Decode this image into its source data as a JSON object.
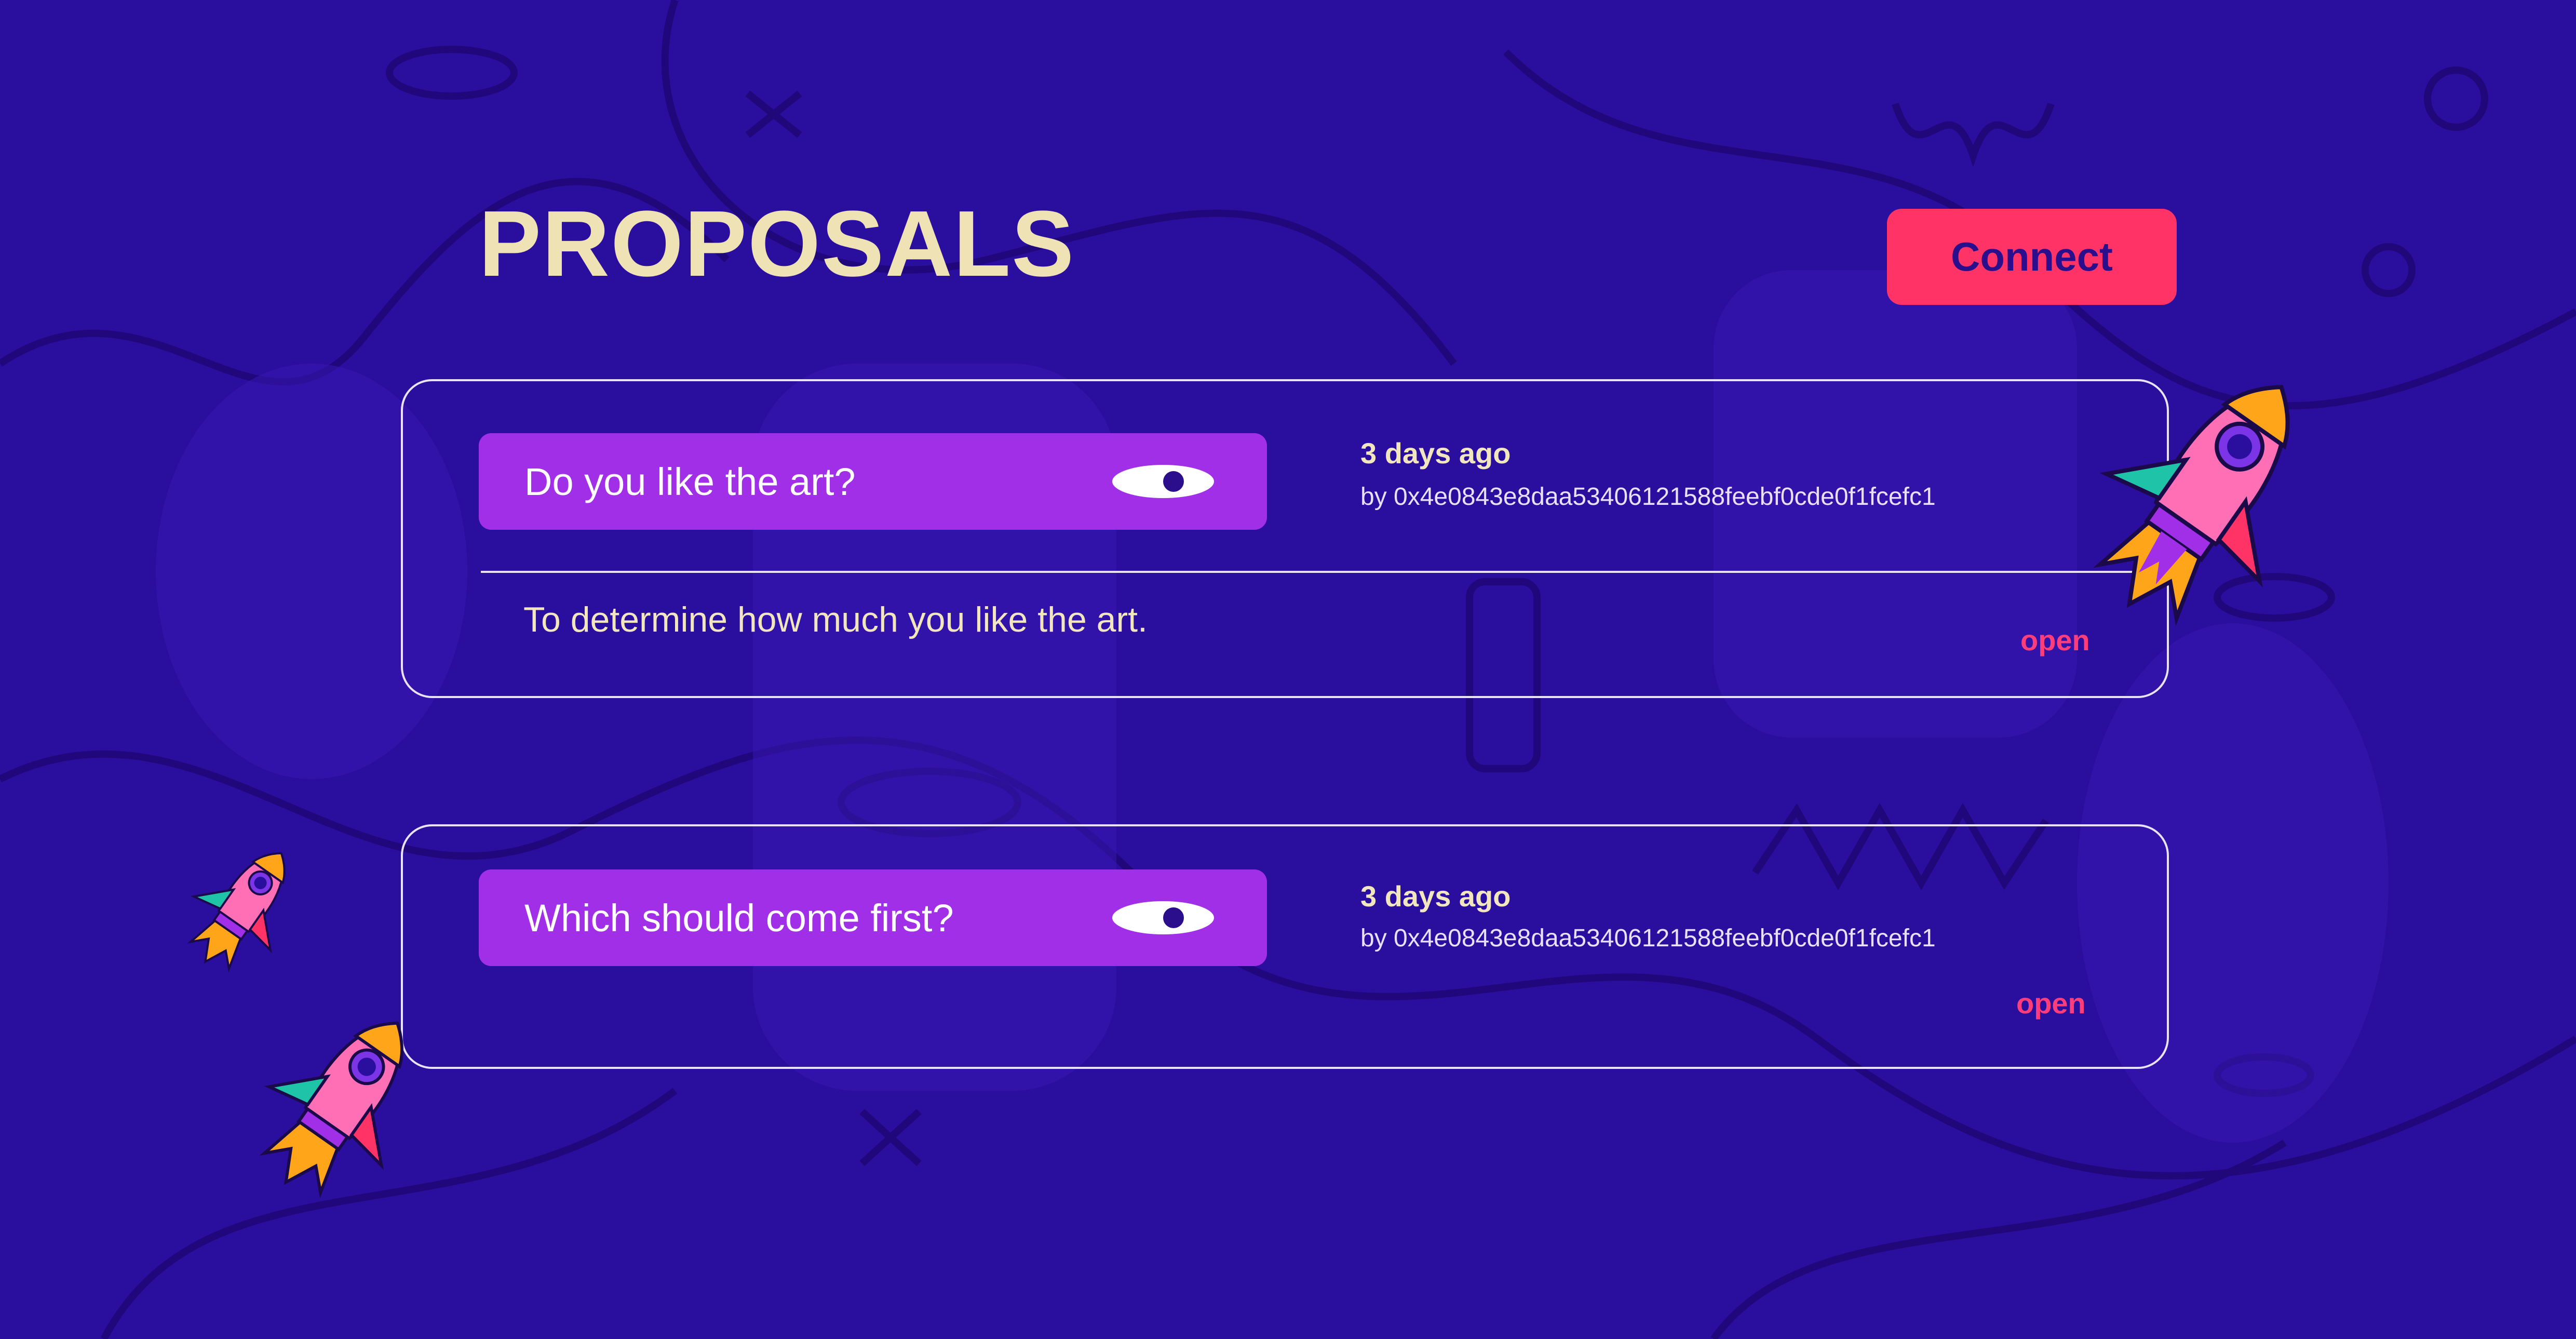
{
  "page": {
    "title": "PROPOSALS",
    "connect_label": "Connect"
  },
  "proposals": [
    {
      "question": "Do you like the art?",
      "time": "3 days ago",
      "author": "by 0x4e0843e8daa53406121588feebf0cde0f1fcefc1",
      "description": "To determine how much you like the art.",
      "status": "open"
    },
    {
      "question": "Which should come first?",
      "time": "3 days ago",
      "author": "by 0x4e0843e8daa53406121588feebf0cde0f1fcefc1",
      "status": "open"
    }
  ],
  "colors": {
    "background": "#2a0e9e",
    "title": "#efe3b6",
    "accent": "#ff3366",
    "question_bg": "#a22fe8",
    "status": "#ff3d7a"
  },
  "icons": [
    "eye-icon",
    "rocket-illustration"
  ]
}
